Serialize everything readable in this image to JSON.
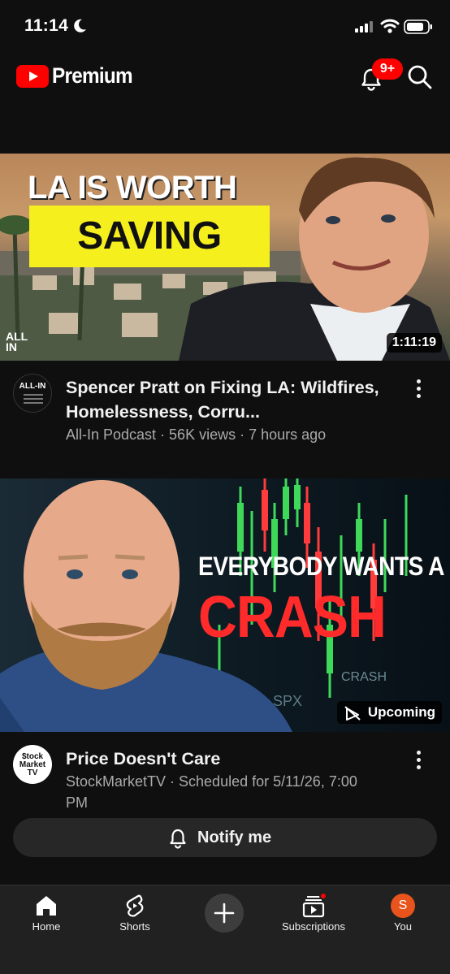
{
  "status_bar": {
    "time": "11:14"
  },
  "header": {
    "brand": "Premium",
    "notification_badge": "9+"
  },
  "videos": [
    {
      "thumbnail": {
        "headline_top": "LA IS WORTH",
        "headline_highlight": "SAVING",
        "watermark": "ALL IN",
        "duration": "1:11:19"
      },
      "avatar_text": "ALL-IN",
      "title": "Spencer Pratt on Fixing LA: Wildfires, Homelessness, Corru...",
      "subtitle": "All-In Podcast · 56K views · 7 hours ago"
    },
    {
      "thumbnail": {
        "headline_top": "EVERYBODY WANTS A",
        "headline_main": "CRASH",
        "chart_label_1": "CRASH",
        "chart_label_2": "SPX",
        "status": "Upcoming"
      },
      "avatar_text": "$tock Market TV",
      "title": "Price Doesn't Care",
      "subtitle": "StockMarketTV · Scheduled for 5/11/26, 7:00 PM",
      "action_label": "Notify me"
    }
  ],
  "bottom_nav": {
    "items": [
      {
        "label": "Home",
        "icon": "home-icon"
      },
      {
        "label": "Shorts",
        "icon": "shorts-icon"
      },
      {
        "label": "",
        "icon": "plus-icon"
      },
      {
        "label": "Subscriptions",
        "icon": "subscriptions-icon"
      },
      {
        "label": "You",
        "icon": "avatar"
      }
    ],
    "user_initial": "S"
  },
  "colors": {
    "background": "#0f0f0f",
    "brand_red": "#ff0000",
    "highlight_yellow": "#f5ef1d",
    "crash_red": "#ff2b2b",
    "avatar_orange": "#e8541b"
  }
}
